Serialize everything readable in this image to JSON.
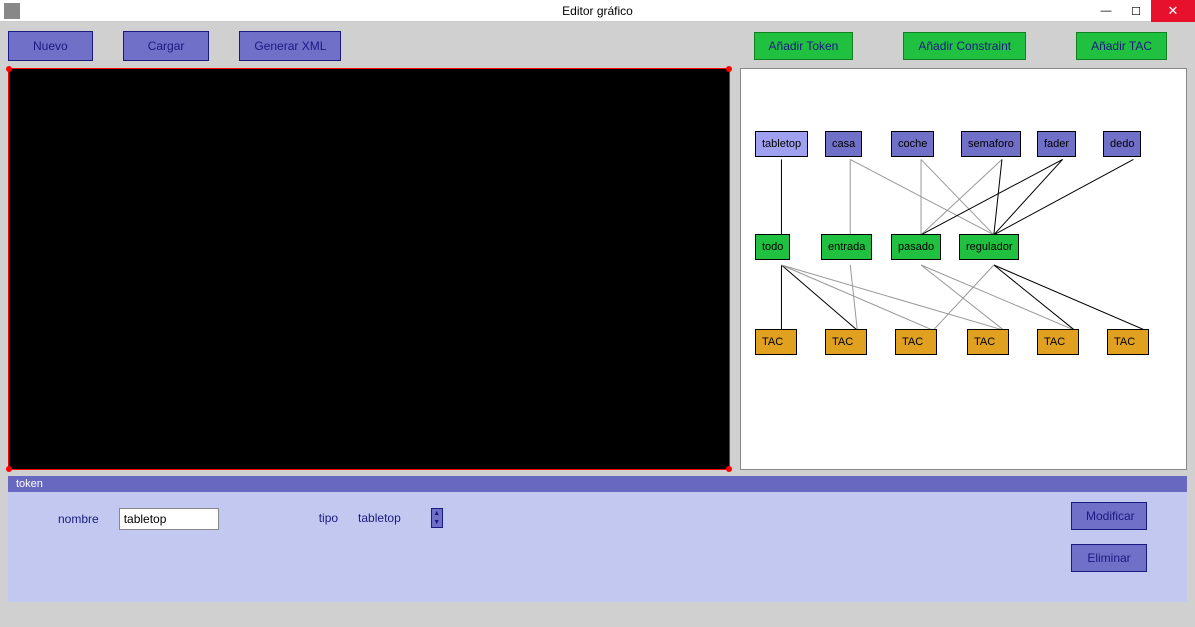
{
  "window": {
    "title": "Editor gráfico"
  },
  "toolbar": {
    "nuevo": "Nuevo",
    "cargar": "Cargar",
    "generar_xml": "Generar XML",
    "add_token": "Añadir Token",
    "add_constraint": "Añadir Constraint",
    "add_tac": "Añadir TAC"
  },
  "graph": {
    "tokens": [
      {
        "id": "tabletop",
        "label": "tabletop"
      },
      {
        "id": "casa",
        "label": "casa"
      },
      {
        "id": "coche",
        "label": "coche"
      },
      {
        "id": "semaforo",
        "label": "semaforo"
      },
      {
        "id": "fader",
        "label": "fader"
      },
      {
        "id": "dedo",
        "label": "dedo"
      }
    ],
    "constraints": [
      {
        "id": "todo",
        "label": "todo"
      },
      {
        "id": "entrada",
        "label": "entrada"
      },
      {
        "id": "pasado",
        "label": "pasado"
      },
      {
        "id": "regulador",
        "label": "regulador"
      }
    ],
    "tacs": [
      {
        "id": "tac1",
        "label": "TAC"
      },
      {
        "id": "tac2",
        "label": "TAC"
      },
      {
        "id": "tac3",
        "label": "TAC"
      },
      {
        "id": "tac4",
        "label": "TAC"
      },
      {
        "id": "tac5",
        "label": "TAC"
      },
      {
        "id": "tac6",
        "label": "TAC"
      }
    ]
  },
  "properties": {
    "section_title": "token",
    "nombre_label": "nombre",
    "nombre_value": "tabletop",
    "tipo_label": "tipo",
    "tipo_value": "tabletop",
    "modificar": "Modificar",
    "eliminar": "Eliminar"
  }
}
